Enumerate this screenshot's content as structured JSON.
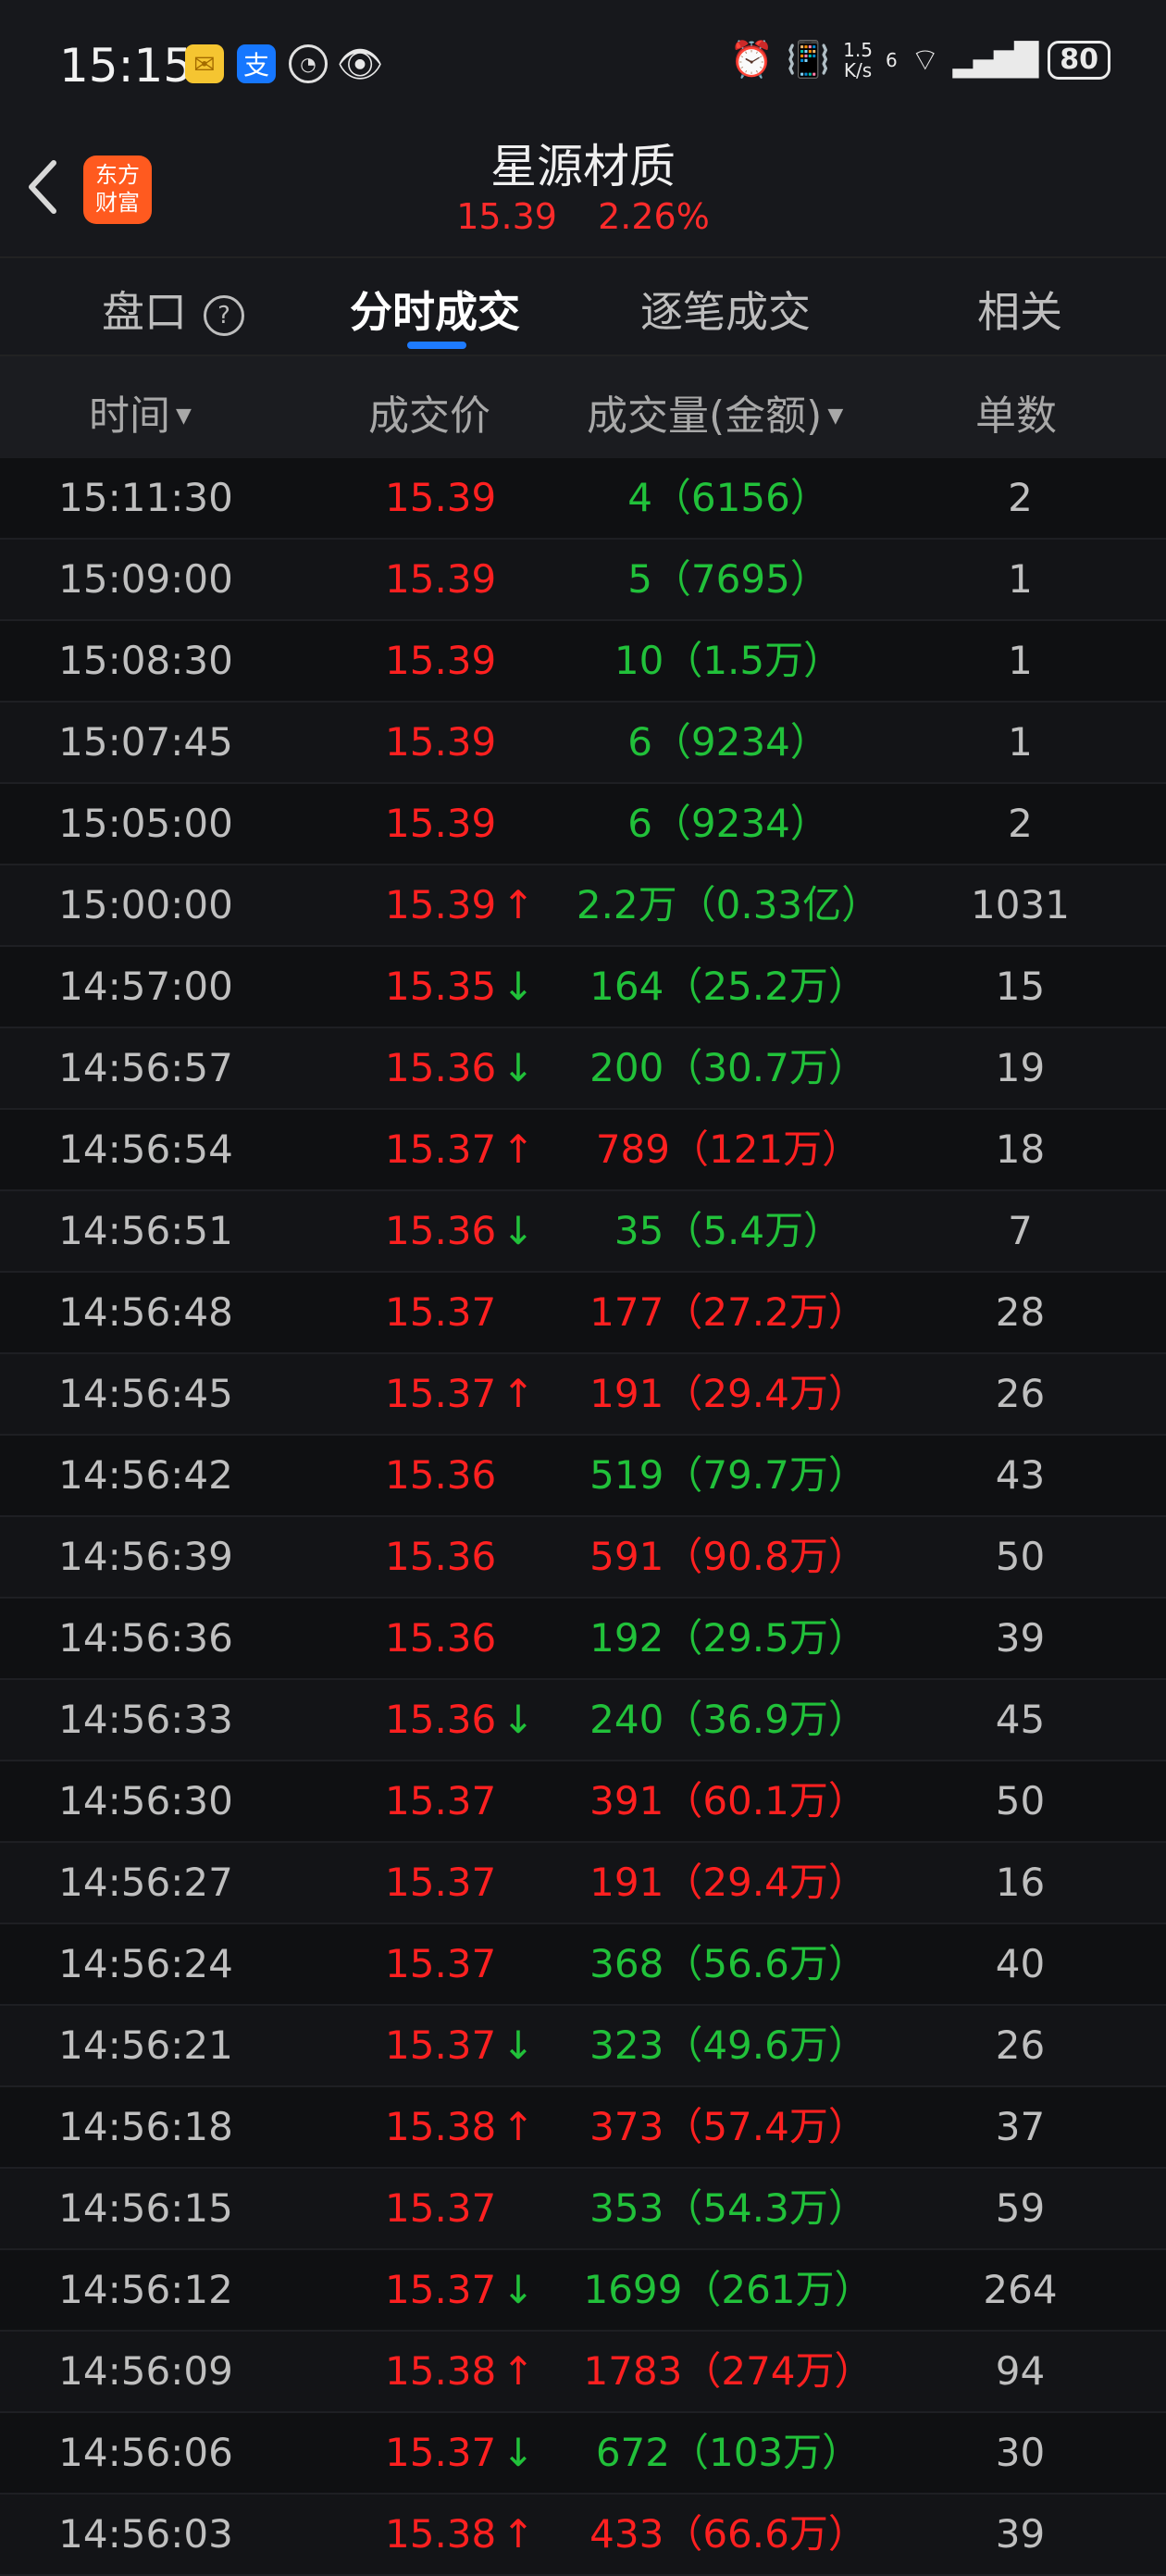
{
  "status_bar": {
    "time": "15:15",
    "net_speed_top": "1.5",
    "net_speed_bottom": "K/s",
    "signal_label": "6",
    "battery": "80",
    "icons": [
      "mail-icon",
      "alipay-icon",
      "app-circle-icon",
      "eye-icon",
      "alarm-icon",
      "vibrate-icon",
      "wifi-icon",
      "signal-icon"
    ]
  },
  "header": {
    "logo_line1": "东方",
    "logo_line2": "财富",
    "stock_name": "星源材质",
    "price": "15.39",
    "change_pct": "2.26%"
  },
  "tabs": [
    {
      "label": "盘口",
      "active": false
    },
    {
      "label": "分时成交",
      "active": true
    },
    {
      "label": "逐笔成交",
      "active": false
    },
    {
      "label": "相关",
      "active": false
    }
  ],
  "columns": {
    "time": "时间",
    "price": "成交价",
    "volume": "成交量(金额)",
    "count": "单数"
  },
  "colors": {
    "up": "#ff2020",
    "down": "#21c13a",
    "accent": "#1e7bff"
  },
  "rows": [
    {
      "time": "15:11:30",
      "price": "15.39",
      "arrow": "",
      "volume": "4（6156）",
      "dir": "down",
      "count": "2"
    },
    {
      "time": "15:09:00",
      "price": "15.39",
      "arrow": "",
      "volume": "5（7695）",
      "dir": "down",
      "count": "1"
    },
    {
      "time": "15:08:30",
      "price": "15.39",
      "arrow": "",
      "volume": "10（1.5万）",
      "dir": "down",
      "count": "1"
    },
    {
      "time": "15:07:45",
      "price": "15.39",
      "arrow": "",
      "volume": "6（9234）",
      "dir": "down",
      "count": "1"
    },
    {
      "time": "15:05:00",
      "price": "15.39",
      "arrow": "",
      "volume": "6（9234）",
      "dir": "down",
      "count": "2"
    },
    {
      "time": "15:00:00",
      "price": "15.39",
      "arrow": "up",
      "volume": "2.2万（0.33亿）",
      "dir": "down",
      "count": "1031"
    },
    {
      "time": "14:57:00",
      "price": "15.35",
      "arrow": "down",
      "volume": "164（25.2万）",
      "dir": "down",
      "count": "15"
    },
    {
      "time": "14:56:57",
      "price": "15.36",
      "arrow": "down",
      "volume": "200（30.7万）",
      "dir": "down",
      "count": "19"
    },
    {
      "time": "14:56:54",
      "price": "15.37",
      "arrow": "up",
      "volume": "789（121万）",
      "dir": "up",
      "count": "18"
    },
    {
      "time": "14:56:51",
      "price": "15.36",
      "arrow": "down",
      "volume": "35（5.4万）",
      "dir": "down",
      "count": "7"
    },
    {
      "time": "14:56:48",
      "price": "15.37",
      "arrow": "",
      "volume": "177（27.2万）",
      "dir": "up",
      "count": "28"
    },
    {
      "time": "14:56:45",
      "price": "15.37",
      "arrow": "up",
      "volume": "191（29.4万）",
      "dir": "up",
      "count": "26"
    },
    {
      "time": "14:56:42",
      "price": "15.36",
      "arrow": "",
      "volume": "519（79.7万）",
      "dir": "down",
      "count": "43"
    },
    {
      "time": "14:56:39",
      "price": "15.36",
      "arrow": "",
      "volume": "591（90.8万）",
      "dir": "up",
      "count": "50"
    },
    {
      "time": "14:56:36",
      "price": "15.36",
      "arrow": "",
      "volume": "192（29.5万）",
      "dir": "down",
      "count": "39"
    },
    {
      "time": "14:56:33",
      "price": "15.36",
      "arrow": "down",
      "volume": "240（36.9万）",
      "dir": "down",
      "count": "45"
    },
    {
      "time": "14:56:30",
      "price": "15.37",
      "arrow": "",
      "volume": "391（60.1万）",
      "dir": "up",
      "count": "50"
    },
    {
      "time": "14:56:27",
      "price": "15.37",
      "arrow": "",
      "volume": "191（29.4万）",
      "dir": "up",
      "count": "16"
    },
    {
      "time": "14:56:24",
      "price": "15.37",
      "arrow": "",
      "volume": "368（56.6万）",
      "dir": "down",
      "count": "40"
    },
    {
      "time": "14:56:21",
      "price": "15.37",
      "arrow": "down",
      "volume": "323（49.6万）",
      "dir": "down",
      "count": "26"
    },
    {
      "time": "14:56:18",
      "price": "15.38",
      "arrow": "up",
      "volume": "373（57.4万）",
      "dir": "up",
      "count": "37"
    },
    {
      "time": "14:56:15",
      "price": "15.37",
      "arrow": "",
      "volume": "353（54.3万）",
      "dir": "down",
      "count": "59"
    },
    {
      "time": "14:56:12",
      "price": "15.37",
      "arrow": "down",
      "volume": "1699（261万）",
      "dir": "down",
      "count": "264"
    },
    {
      "time": "14:56:09",
      "price": "15.38",
      "arrow": "up",
      "volume": "1783（274万）",
      "dir": "up",
      "count": "94"
    },
    {
      "time": "14:56:06",
      "price": "15.37",
      "arrow": "down",
      "volume": "672（103万）",
      "dir": "down",
      "count": "30"
    },
    {
      "time": "14:56:03",
      "price": "15.38",
      "arrow": "up",
      "volume": "433（66.6万）",
      "dir": "up",
      "count": "39"
    }
  ]
}
